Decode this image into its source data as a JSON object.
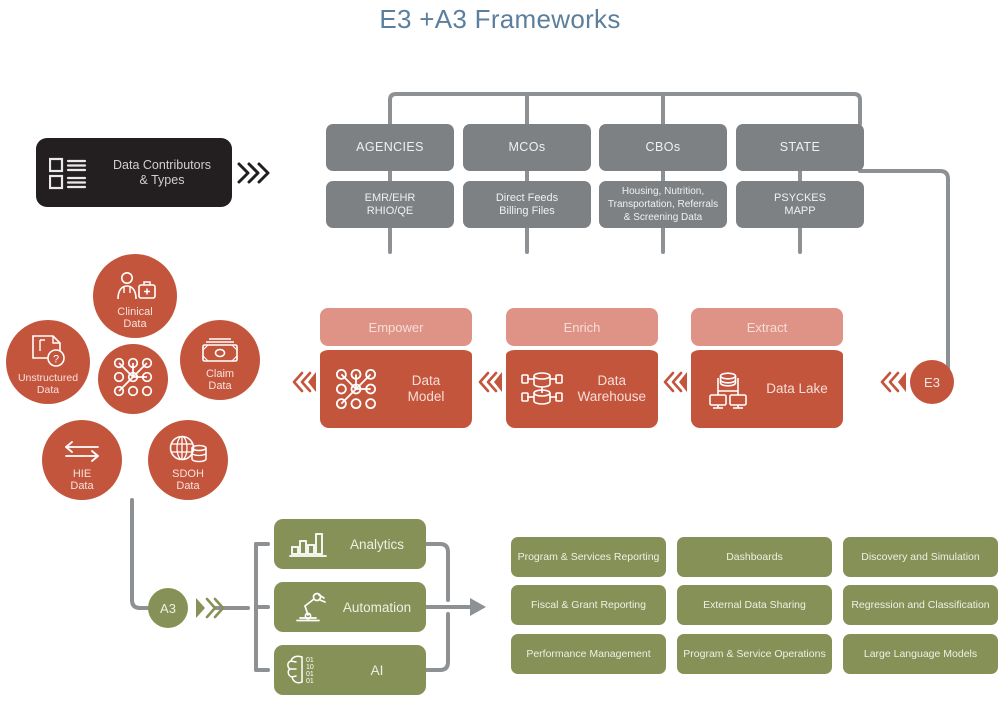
{
  "title": "E3 +A3 Frameworks",
  "colors": {
    "title": "#5b7f9c",
    "terracotta": "#c4553d",
    "salmon": "#df9387",
    "olive": "#869157",
    "gray": "#7e8184",
    "connector": "#8e9194",
    "black_box": "#231f20"
  },
  "contributors": {
    "label": "Data Contributors\n& Types",
    "icon": "list-checklist-icon",
    "arrow": "triple-chevron-right-icon"
  },
  "sources": {
    "columns": [
      {
        "heading": "AGENCIES",
        "detail": "EMR/EHR\nRHIO/QE"
      },
      {
        "heading": "MCOs",
        "detail": "Direct Feeds\nBilling Files"
      },
      {
        "heading": "CBOs",
        "detail": "Housing, Nutrition,\nTransportation, Referrals\n& Screening Data"
      },
      {
        "heading": "STATE",
        "detail": "PSYCKES\nMAPP"
      }
    ]
  },
  "data_types": {
    "hub_icon": "network-nodes-icon",
    "petals": [
      {
        "label": "Clinical\nData",
        "icon": "doctor-medical-kit-icon"
      },
      {
        "label": "Claim\nData",
        "icon": "money-bill-icon"
      },
      {
        "label": "SDOH\nData",
        "icon": "globe-database-icon"
      },
      {
        "label": "HIE\nData",
        "icon": "exchange-arrows-icon"
      },
      {
        "label": "Unstructured\nData",
        "icon": "document-question-icon"
      }
    ]
  },
  "e3": {
    "badge": "E3",
    "stages": [
      {
        "head": "Empower",
        "body": "Data\nModel",
        "icon": "network-nodes-icon"
      },
      {
        "head": "Enrich",
        "body": "Data\nWarehouse",
        "icon": "database-stack-icon"
      },
      {
        "head": "Extract",
        "body": "Data Lake",
        "icon": "server-clients-icon"
      }
    ],
    "stage_arrow": "triple-chevron-left-icon"
  },
  "a3": {
    "badge": "A3",
    "badge_arrow": "triple-chevron-right-icon",
    "capabilities": [
      {
        "label": "Analytics",
        "icon": "bar-chart-icon"
      },
      {
        "label": "Automation",
        "icon": "robot-arm-icon"
      },
      {
        "label": "AI",
        "icon": "brain-binary-icon"
      }
    ],
    "flow_arrow": "arrow-right-icon",
    "outcomes": [
      "Program & Services Reporting",
      "Dashboards",
      "Discovery and Simulation",
      "Fiscal & Grant Reporting",
      "External Data Sharing",
      "Regression and Classification",
      "Performance Management",
      "Program & Service Operations",
      "Large Language Models"
    ]
  }
}
